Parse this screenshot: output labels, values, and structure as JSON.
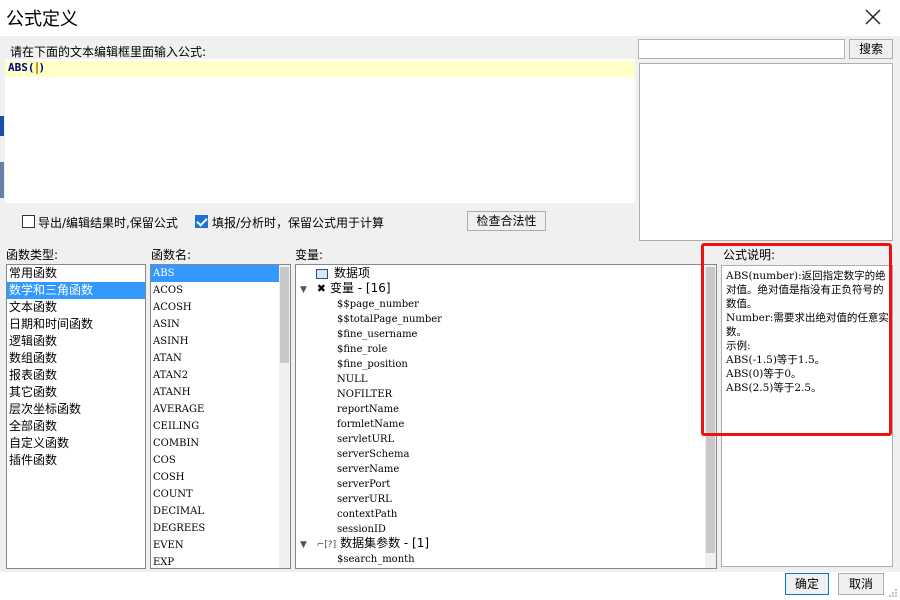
{
  "window": {
    "title": "公式定义"
  },
  "editor": {
    "prompt": "请在下面的文本编辑框里面输入公式:",
    "formula_fn": "ABS",
    "formula_open": "(",
    "formula_close": ")"
  },
  "search": {
    "placeholder": "",
    "button_label": "搜索"
  },
  "options": {
    "export_keep": {
      "label": "导出/编辑结果时,保留公式",
      "checked": false
    },
    "fill_keep": {
      "label": "填报/分析时，保留公式用于计算",
      "checked": true
    },
    "validate_label": "检查合法性"
  },
  "categories": {
    "header": "函数类型:",
    "items": [
      "常用函数",
      "数学和三角函数",
      "文本函数",
      "日期和时间函数",
      "逻辑函数",
      "数组函数",
      "报表函数",
      "其它函数",
      "层次坐标函数",
      "全部函数",
      "自定义函数",
      "插件函数"
    ],
    "selected_index": 1
  },
  "functions": {
    "header": "函数名:",
    "items": [
      "ABS",
      "ACOS",
      "ACOSH",
      "ASIN",
      "ASINH",
      "ATAN",
      "ATAN2",
      "ATANH",
      "AVERAGE",
      "CEILING",
      "COMBIN",
      "COS",
      "COSH",
      "COUNT",
      "DECIMAL",
      "DEGREES",
      "EVEN",
      "EXP"
    ],
    "selected_index": 0
  },
  "variables": {
    "header": "变量:",
    "dataitem_label": "数据项",
    "group_var": "变量 - [16]",
    "var_items": [
      "$$page_number",
      "$$totalPage_number",
      "$fine_username",
      "$fine_role",
      "$fine_position",
      "NULL",
      "NOFILTER",
      "reportName",
      "formletName",
      "servletURL",
      "serverSchema",
      "serverName",
      "serverPort",
      "serverURL",
      "contextPath",
      "sessionID"
    ],
    "group_ds": "数据集参数 - [1]",
    "ds_items": [
      "$search_month"
    ]
  },
  "description": {
    "header": "公式说明:",
    "text": "ABS(number):返回指定数字的绝对值。绝对值是指没有正负符号的数值。\nNumber:需要求出绝对值的任意实数。\n示例:\nABS(-1.5)等于1.5。\nABS(0)等于0。\nABS(2.5)等于2.5。"
  },
  "footer": {
    "ok_label": "确定",
    "cancel_label": "取消"
  },
  "colors": {
    "selection": "#3399ff",
    "highlight_box": "#ee1111",
    "editor_line": "#ffffc6"
  }
}
